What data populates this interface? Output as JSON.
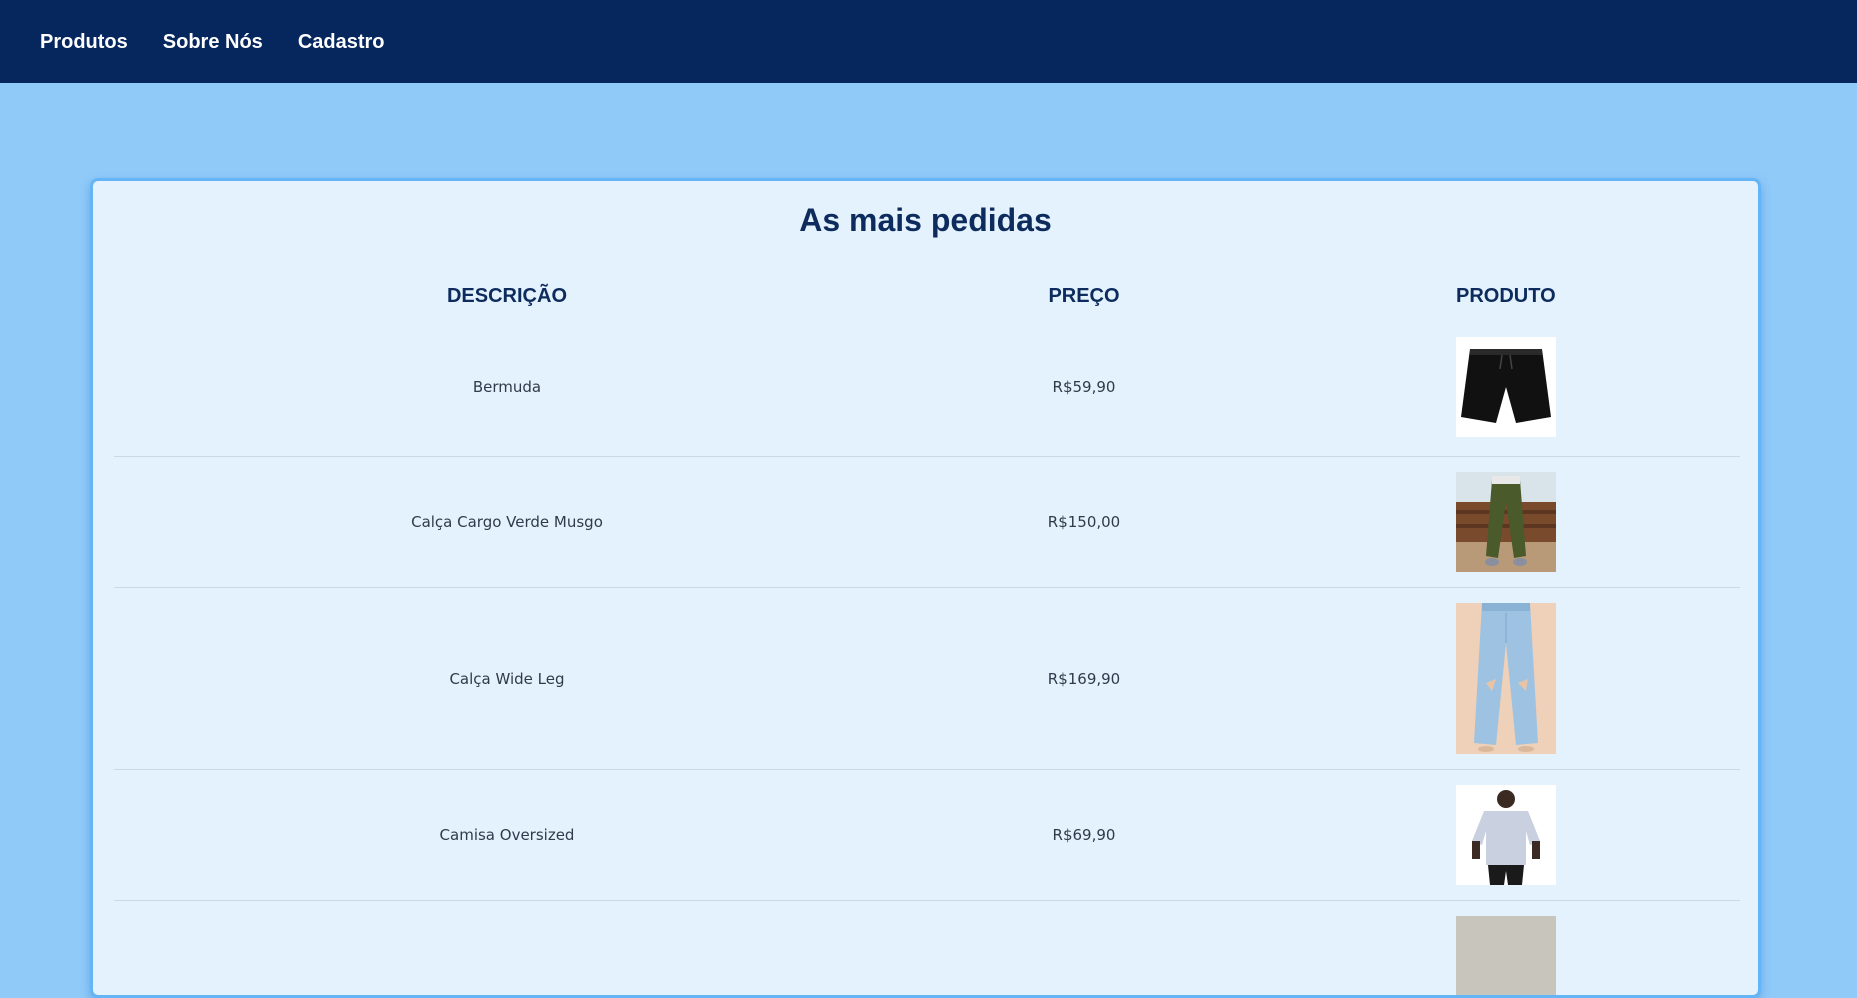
{
  "nav": {
    "items": [
      {
        "label": "Produtos"
      },
      {
        "label": "Sobre Nós"
      },
      {
        "label": "Cadastro"
      }
    ]
  },
  "card": {
    "title": "As mais pedidas"
  },
  "table": {
    "headers": {
      "description": "DESCRIÇÃO",
      "price": "PREÇO",
      "product": "PRODUTO"
    },
    "rows": [
      {
        "description": "Bermuda",
        "price": "R$59,90",
        "image": "black-shorts-image"
      },
      {
        "description": "Calça Cargo Verde Musgo",
        "price": "R$150,00",
        "image": "green-cargo-pants-image"
      },
      {
        "description": "Calça Wide Leg",
        "price": "R$169,90",
        "image": "wide-leg-jeans-image"
      },
      {
        "description": "Camisa Oversized",
        "price": "R$69,90",
        "image": "oversized-shirt-image"
      }
    ]
  },
  "colors": {
    "navbar": "#06265e",
    "page_background": "#90caf9",
    "card_background": "#e3f2fd",
    "card_border": "#64b5f6",
    "heading": "#0d2b5c"
  }
}
